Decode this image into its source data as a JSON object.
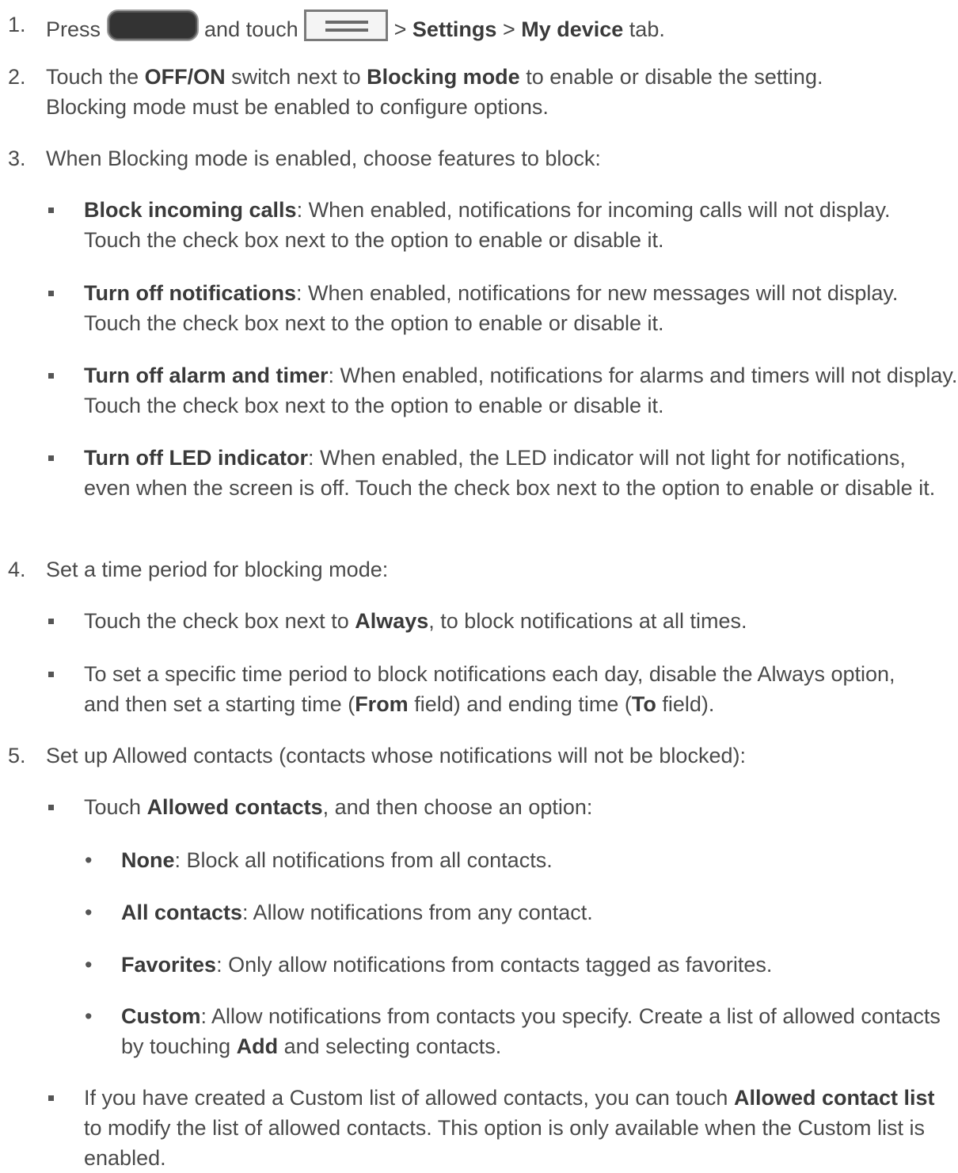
{
  "steps": [
    {
      "num": "1.",
      "t1": "Press ",
      "t2": " and touch ",
      "t3": " > ",
      "b1": "Settings",
      "t4": " > ",
      "b2": "My device",
      "t5": " tab."
    },
    {
      "num": "2.",
      "t1": "Touch the ",
      "b1": "OFF/ON",
      "t2": " switch next to ",
      "b2": "Blocking mode",
      "t3": " to enable or disable the setting. Blocking mode must be enabled to configure options."
    },
    {
      "num": "3.",
      "text": "When Blocking mode is enabled, choose features to block:",
      "items": [
        {
          "b": "Block incoming calls",
          "t": ": When enabled, notifications for incoming calls will not display. Touch the check box next to the option to enable or disable it."
        },
        {
          "b": "Turn off notifications",
          "t": ": When enabled, notifications for new messages will not display. Touch the check box next to the option to enable or disable it."
        },
        {
          "b": "Turn off alarm and timer",
          "t": ": When enabled, notifications for alarms and timers will not display. Touch the check box next to the option to enable or disable it."
        },
        {
          "b": "Turn off LED indicator",
          "t": ": When enabled, the LED indicator will not light for notifications, even when the screen is off. Touch the check box next to the option to enable or disable it."
        }
      ]
    },
    {
      "num": "4.",
      "text": "Set a time period for blocking mode:",
      "item1": {
        "t1": "Touch the check box next to ",
        "b1": "Always",
        "t2": ", to block notifications at all times."
      },
      "item2": {
        "t1": "To set a specific time period to block notifications each day, disable the Always option, and then set a starting time (",
        "b1": "From",
        "t2": " field) and ending time (",
        "b2": "To",
        "t3": " field)."
      }
    },
    {
      "num": "5.",
      "text": "Set up Allowed contacts (contacts whose notifications will not be blocked):",
      "item1": {
        "t1": "Touch ",
        "b1": "Allowed contacts",
        "t2": ", and then choose an option:"
      },
      "options": [
        {
          "b": "None",
          "t": ": Block all notifications from all contacts."
        },
        {
          "b": "All contacts",
          "t": ": Allow notifications from any contact."
        },
        {
          "b": "Favorites",
          "t": ": Only allow notifications from contacts tagged as favorites."
        },
        {
          "b": "Custom",
          "t1": ": Allow notifications from contacts you specify. Create a list of allowed contacts by touching ",
          "b2": "Add",
          "t2": " and selecting contacts."
        }
      ],
      "item2": {
        "t1": "If you have created a Custom list of allowed contacts, you can touch ",
        "b1": "Allowed contact list",
        "t2": " to modify the list of allowed contacts. This option is only available when the Custom list is enabled."
      }
    }
  ]
}
